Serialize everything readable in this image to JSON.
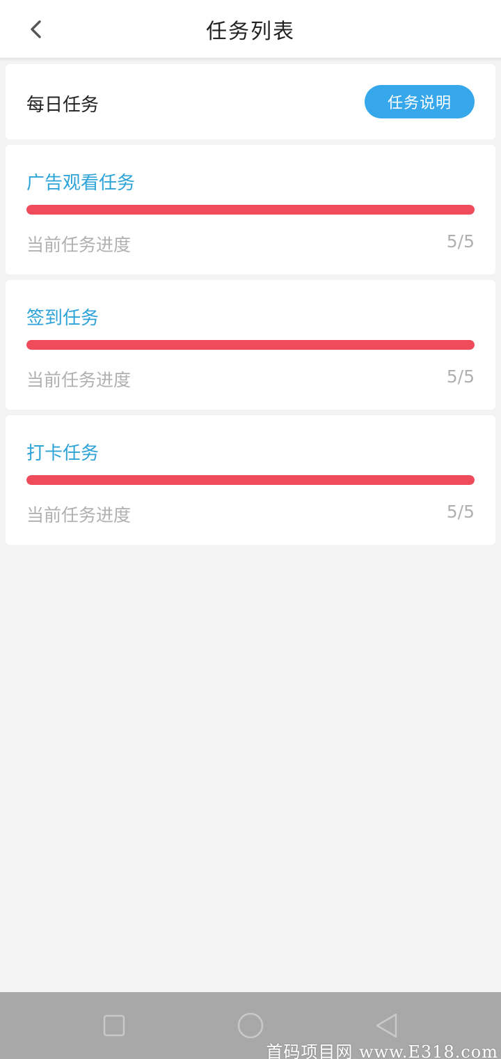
{
  "header": {
    "title": "任务列表",
    "back_icon": "chevron-left-icon"
  },
  "daily": {
    "title": "每日任务",
    "explain_button": "任务说明"
  },
  "tasks": [
    {
      "title": "广告观看任务",
      "progress_label": "当前任务进度",
      "count": "5/5",
      "progress": 1.0
    },
    {
      "title": "签到任务",
      "progress_label": "当前任务进度",
      "count": "5/5",
      "progress": 1.0
    },
    {
      "title": "打卡任务",
      "progress_label": "当前任务进度",
      "count": "5/5",
      "progress": 1.0
    }
  ],
  "colors": {
    "accent": "#36a7ea",
    "task_title": "#2ea3d8",
    "progress": "#f04b5b",
    "background": "#f3f3f3"
  },
  "navbar": {
    "icons": [
      "recent-apps-icon",
      "home-icon",
      "back-triangle-icon"
    ]
  },
  "watermark": "首码项目网 www.E318.com"
}
